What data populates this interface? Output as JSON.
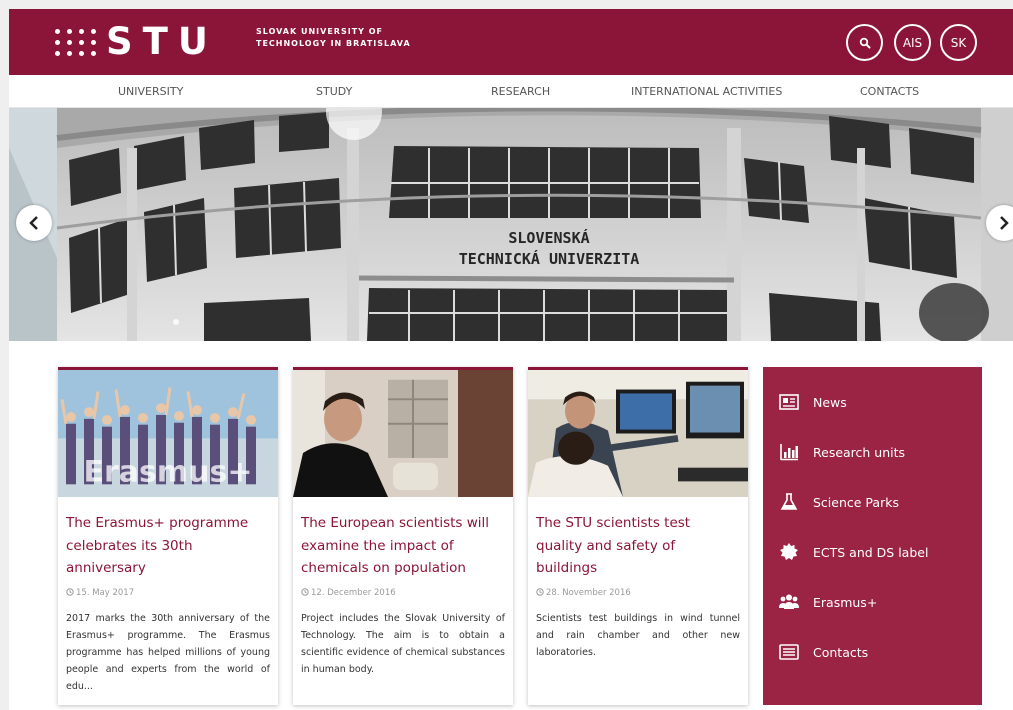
{
  "header": {
    "logo_text": "STU",
    "university_line1": "SLOVAK UNIVERSITY OF",
    "university_line2": "TECHNOLOGY IN BRATISLAVA",
    "ais_label": "AIS",
    "lang_label": "SK",
    "search_icon": "search-icon",
    "brand_color": "#8b1538"
  },
  "nav": {
    "items": [
      "UNIVERSITY",
      "STUDY",
      "RESEARCH",
      "INTERNATIONAL ACTIVITIES",
      "CONTACTS"
    ]
  },
  "hero": {
    "sign_line1": "SLOVENSKÁ",
    "sign_line2": "TECHNICKÁ UNIVERZITA"
  },
  "news": [
    {
      "title": "The Erasmus+ programme celebrates its 30th anniversary",
      "date": "15. May 2017",
      "text": "2017 marks the 30th anniversary of the Erasmus+ programme. The Erasmus programme has helped millions of young people and experts from the world of edu...",
      "image_text": "Erasmus+"
    },
    {
      "title": "The European scientists will examine the impact of chemicals on population",
      "date": "12. December 2016",
      "text": "Project includes the Slovak University of Technology. The aim is to obtain a scientific evidence of chemical substances in human body."
    },
    {
      "title": "The STU scientists test quality and safety of buildings",
      "date": "28. November 2016",
      "text": "Scientists test buildings in wind tunnel and rain chamber and other new laboratories."
    }
  ],
  "sidebar": {
    "background": "#9b2445",
    "items": [
      {
        "label": "News",
        "icon": "newspaper-icon"
      },
      {
        "label": "Research units",
        "icon": "bar-chart-icon"
      },
      {
        "label": "Science Parks",
        "icon": "flask-icon"
      },
      {
        "label": "ECTS and DS label",
        "icon": "badge-icon"
      },
      {
        "label": "Erasmus+",
        "icon": "users-icon"
      },
      {
        "label": "Contacts",
        "icon": "address-card-icon"
      }
    ]
  }
}
